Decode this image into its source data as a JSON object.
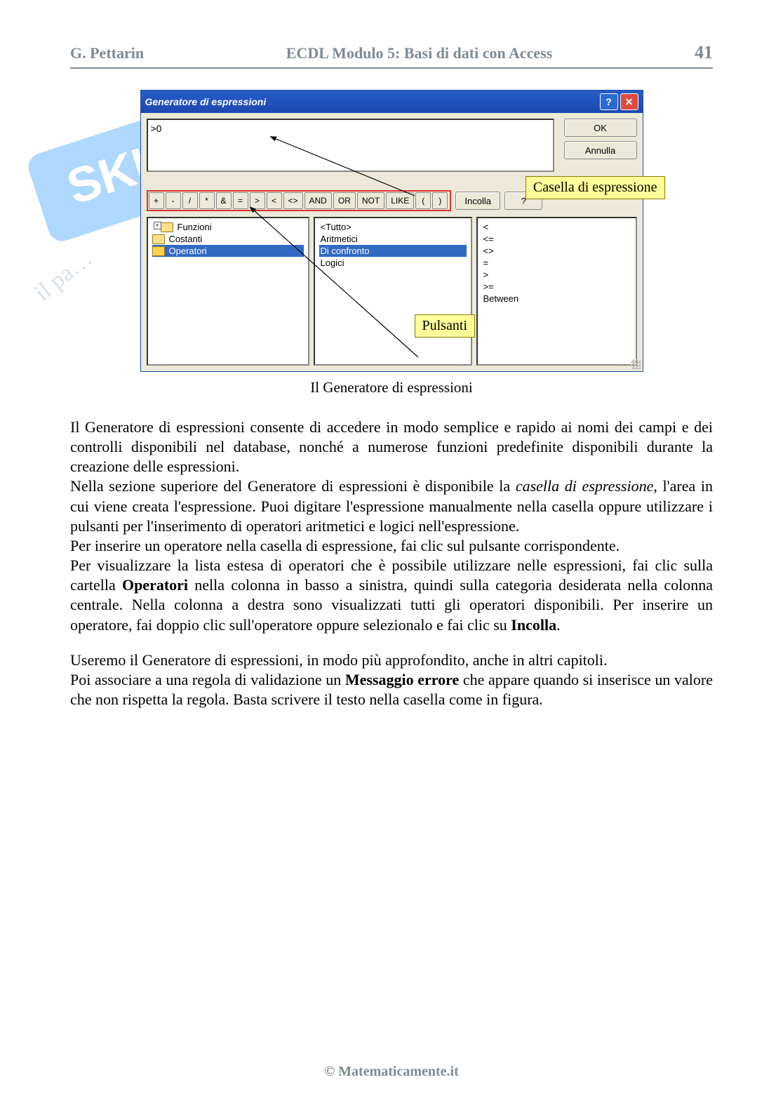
{
  "header": {
    "left": "G. Pettarin",
    "center": "ECDL Modulo 5: Basi di dati con Access",
    "right": "41"
  },
  "window": {
    "title": "Generatore di espressioni",
    "expr_value": ">0",
    "buttons": {
      "ok": "OK",
      "cancel": "Annulla",
      "paste": "Incolla",
      "help": "?"
    },
    "ops": [
      "+",
      "-",
      "/",
      "*",
      "&",
      "=",
      ">",
      "<",
      "<>",
      "AND",
      "OR",
      "NOT",
      "LIKE",
      "(",
      ")"
    ],
    "left_col": [
      {
        "label": "Funzioni",
        "icon": "plus"
      },
      {
        "label": "Costanti",
        "icon": "closed"
      },
      {
        "label": "Operatori",
        "icon": "open",
        "selected": true
      }
    ],
    "mid_col": [
      {
        "label": "<Tutto>"
      },
      {
        "label": "Aritmetici"
      },
      {
        "label": "Di confronto",
        "selected": true
      },
      {
        "label": "Logici"
      }
    ],
    "right_col": [
      "<",
      "<=",
      "<>",
      "=",
      ">",
      ">=",
      "Between"
    ]
  },
  "callouts": {
    "expr": "Casella di espressione",
    "buttons": "Pulsanti"
  },
  "caption": "Il Generatore di espressioni",
  "paragraphs": {
    "p1a": "Il Generatore di espressioni consente di accedere in modo semplice e rapido ai nomi dei campi e dei controlli disponibili nel database, nonché a numerose funzioni predefinite disponibili durante la creazione delle espressioni.",
    "p1b_pre": "Nella sezione superiore del Generatore di espressioni è disponibile la ",
    "p1b_em": "casella di espressione",
    "p1b_post": ", l'area in cui viene creata l'espressione. Puoi digitare l'espressione manualmente nella casella oppure utilizzare i pulsanti per l'inserimento di operatori aritmetici e logici nell'espressione.",
    "p1c": "Per inserire un operatore nella casella di espressione, fai clic sul pulsante corrispondente.",
    "p1d_pre": "Per visualizzare la lista estesa di operatori che è possibile utilizzare nelle espressioni, fai clic sulla cartella ",
    "p1d_b1": "Operatori",
    "p1d_mid": " nella colonna in basso a sinistra, quindi sulla categoria desiderata nella colonna centrale. Nella colonna a destra sono visualizzati tutti gli operatori disponibili. Per inserire un operatore, fai doppio clic sull'operatore oppure selezionalo e fai clic su ",
    "p1d_b2": "Incolla",
    "p1d_post": ".",
    "p2a": "Useremo il Generatore di espressioni, in modo più approfondito, anche in altri capitoli.",
    "p2b_pre": "Poi associare a una regola di validazione un ",
    "p2b_b": "Messaggio errore",
    "p2b_post": " che appare quando si inserisce un valore che non rispetta la regola. Basta scrivere il testo nella casella come in figura."
  },
  "footer": "© Matematicamente.it"
}
